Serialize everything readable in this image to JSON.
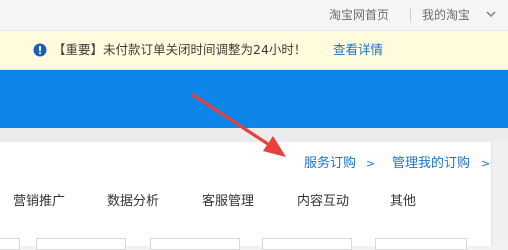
{
  "top_bar": {
    "home_link": "淘宝网首页",
    "my_taobao": "我的淘宝"
  },
  "notice": {
    "text": "【重要】未付款订单关闭时间调整为24小时！",
    "link": "查看详情"
  },
  "service": {
    "order_link": "服务订购",
    "manage_link": "管理我的订购",
    "arrow_symbol": ">"
  },
  "nav": {
    "items": [
      {
        "label": "营销推广"
      },
      {
        "label": "数据分析"
      },
      {
        "label": "客服管理"
      },
      {
        "label": "内容互动"
      },
      {
        "label": "其他"
      }
    ]
  },
  "colors": {
    "banner": "#0c85e8",
    "link": "#1a73c9",
    "notice_bg": "#fffbdc",
    "annotation_arrow": "#e8403a"
  }
}
